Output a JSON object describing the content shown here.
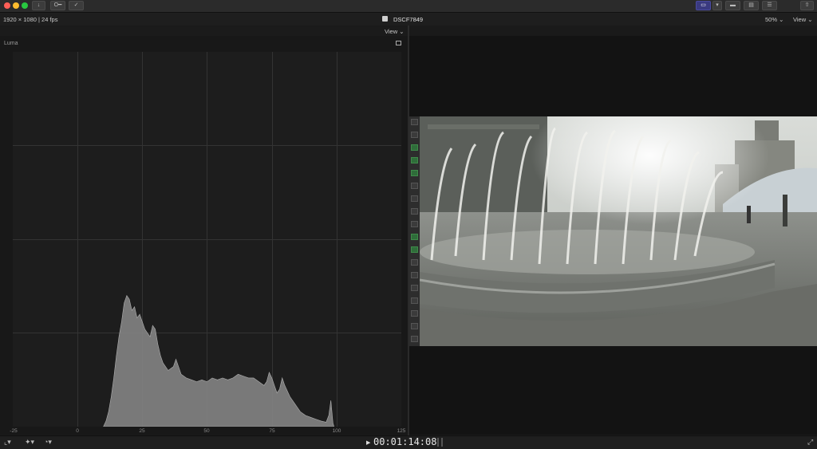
{
  "toolbar": {
    "import_icon": "download-icon",
    "keywords_label": "O━",
    "background_tasks_icon": "checkmark-circle-icon",
    "share_icon": "share-icon"
  },
  "header": {
    "format_info": "1920 × 1080 | 24 fps",
    "clip_name": "DSCF7849",
    "zoom_label": "50%",
    "view_label": "View"
  },
  "scope": {
    "view_label": "View",
    "title": "Luma",
    "x_ticks": [
      "-25",
      "0",
      "25",
      "50",
      "75",
      "100",
      "125"
    ]
  },
  "chart_data": {
    "type": "area",
    "title": "Luma",
    "xlabel": "",
    "ylabel": "",
    "xlim": [
      -25,
      125
    ],
    "ylim": [
      0,
      100
    ],
    "grid": true,
    "x": [
      10,
      11,
      12,
      13,
      14,
      15,
      16,
      17,
      18,
      19,
      20,
      21,
      22,
      23,
      24,
      25,
      26,
      27,
      28,
      29,
      30,
      31,
      32,
      33,
      35,
      37,
      38,
      39,
      40,
      42,
      44,
      46,
      48,
      50,
      52,
      54,
      56,
      58,
      60,
      62,
      64,
      66,
      68,
      70,
      72,
      73,
      74,
      75,
      76,
      77,
      78,
      79,
      80,
      82,
      84,
      86,
      88,
      90,
      92,
      94,
      96,
      97,
      97.8,
      98.2,
      98.6,
      99
    ],
    "values": [
      0,
      1.5,
      4,
      8,
      13,
      19,
      24,
      28,
      33,
      35,
      34,
      31,
      32,
      29,
      30,
      28,
      26,
      25,
      24,
      27,
      26,
      22,
      19,
      17,
      15,
      16,
      18,
      16,
      14,
      13,
      12.5,
      12,
      12.5,
      12,
      13,
      12.5,
      13,
      12.5,
      13,
      14,
      13.5,
      13,
      13,
      12,
      11,
      12,
      14.5,
      13,
      11,
      9,
      10,
      13,
      11,
      8,
      6,
      4,
      3,
      2.5,
      2,
      1.5,
      1.2,
      3,
      7,
      4,
      1,
      0
    ]
  },
  "timecode": {
    "play_icon": "play-icon",
    "value": "00:01:14:08"
  },
  "colors": {
    "accent": "#3a3a80",
    "histogram_fill": "#8a8a8a",
    "grid": "#333333"
  }
}
